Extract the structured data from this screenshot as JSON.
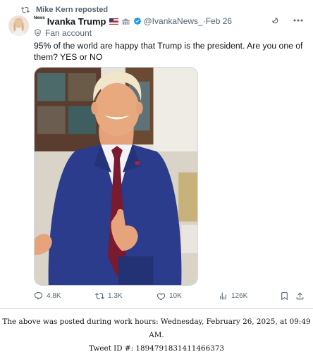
{
  "repost": {
    "label": "Mike Kern reposted"
  },
  "author": {
    "news_tag": "News",
    "display_name": "Ivanka Trump",
    "handle": "@IvankaNews_",
    "separator": " · ",
    "date": "Feb 26",
    "fan_label": "Fan account"
  },
  "tweet": {
    "text": "95% of the world are happy that Trump is the president. Are you one of them? YES or NO"
  },
  "actions": {
    "replies": "4.8K",
    "reposts": "1.3K",
    "likes": "10K",
    "views": "126K"
  },
  "colors": {
    "verified": "#1d9bf0",
    "secondary_text": "#536471",
    "suit": "#2b3c8c",
    "tie": "#7a1a2e"
  },
  "icons": [
    "repost-icon",
    "flag-icon",
    "house-icon",
    "verified-icon",
    "grok-icon",
    "more-icon",
    "fan-shield-icon",
    "reply-icon",
    "repost-action-icon",
    "like-icon",
    "views-icon",
    "bookmark-icon",
    "share-icon"
  ],
  "footer": {
    "line1": "The above was posted during work hours: Wednesday, February 26, 2025, at 09:49 AM.",
    "line2": "Tweet ID #: 1894791831411466373"
  }
}
